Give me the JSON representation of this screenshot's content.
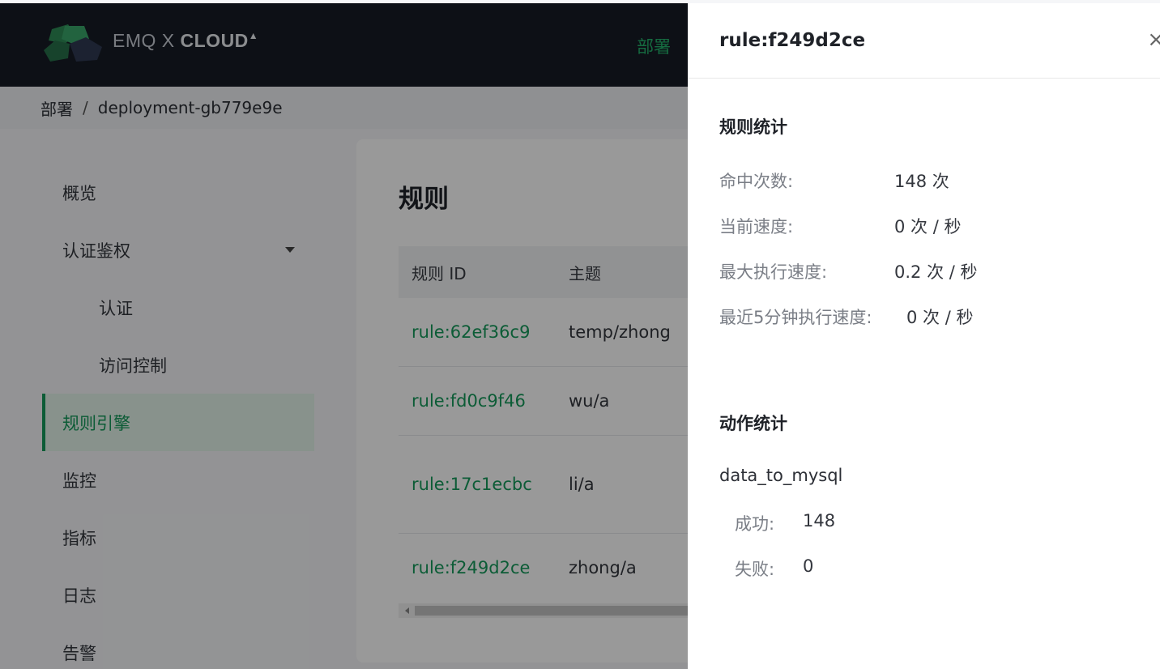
{
  "header": {
    "brand_prefix": "EMQ X ",
    "brand_bold": "CLOUD",
    "nav_active": "部署",
    "colors": {
      "bg": "#171c26",
      "accent": "#24b36b"
    }
  },
  "breadcrumb": {
    "root": "部署",
    "separator": "/",
    "current": "deployment-gb779e9e"
  },
  "sidebar": {
    "items": [
      {
        "label": "概览"
      },
      {
        "label": "认证鉴权"
      },
      {
        "label": "认证"
      },
      {
        "label": "访问控制"
      },
      {
        "label": "规则引擎"
      },
      {
        "label": "监控"
      },
      {
        "label": "指标"
      },
      {
        "label": "日志"
      },
      {
        "label": "告警"
      }
    ]
  },
  "main": {
    "title": "规则",
    "table": {
      "headers": [
        "规则 ID",
        "主题"
      ],
      "rows": [
        {
          "id": "rule:62ef36c9",
          "topic": "temp/zhong"
        },
        {
          "id": "rule:fd0c9f46",
          "topic": "wu/a"
        },
        {
          "id": "rule:17c1ecbc",
          "topic": "li/a"
        },
        {
          "id": "rule:f249d2ce",
          "topic": "zhong/a"
        }
      ]
    }
  },
  "drawer": {
    "title": "rule:f249d2ce",
    "close_icon": "×",
    "rule_stats": {
      "title": "规则统计",
      "rows": [
        {
          "label": "命中次数:",
          "value": "148 次"
        },
        {
          "label": "当前速度:",
          "value": "0 次 / 秒"
        },
        {
          "label": "最大执行速度:",
          "value": "0.2 次 / 秒"
        },
        {
          "label": "最近5分钟执行速度:",
          "value": "0 次 / 秒"
        }
      ]
    },
    "action_stats": {
      "title": "动作统计",
      "action_name": "data_to_mysql",
      "success_label": "成功:",
      "success_value": "148",
      "fail_label": "失败:",
      "fail_value": "0"
    }
  }
}
